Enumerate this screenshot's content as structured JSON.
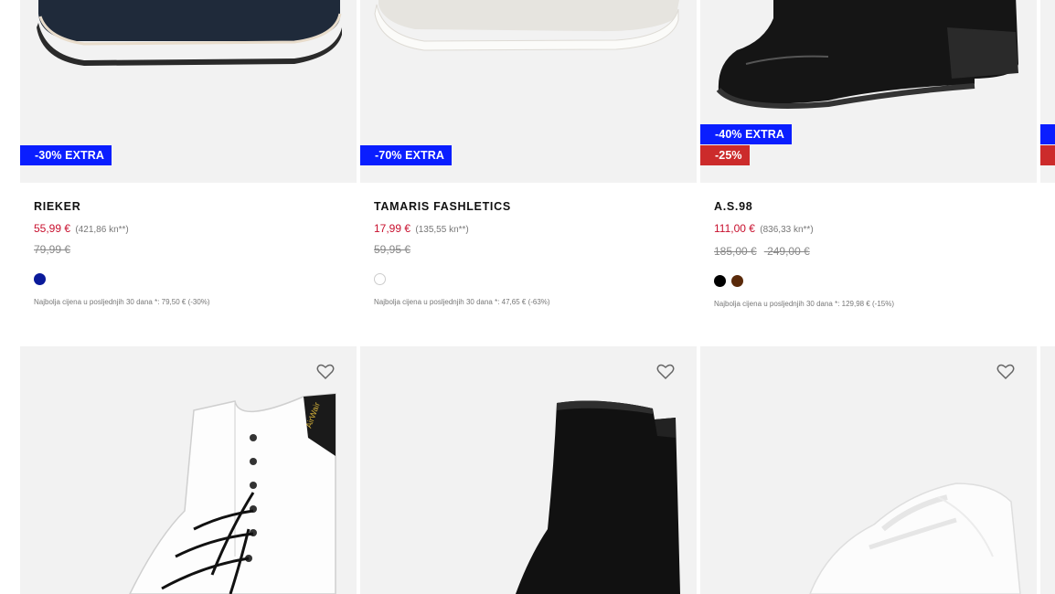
{
  "products_top": [
    {
      "badge_extra": "-30% EXTRA",
      "badge_discount": null,
      "brand": "RIEKER",
      "price": "55,99 €",
      "price_kn": "(421,86 kn**)",
      "old_prices": [
        "79,99 €"
      ],
      "swatches": [
        "#0a1a9a"
      ],
      "lowest_price_note": "Najbolja cijena u posljednjih 30 dana *: 79,50 € (-30%)"
    },
    {
      "badge_extra": "-70% EXTRA",
      "badge_discount": null,
      "brand": "TAMARIS FASHLETICS",
      "price": "17,99 €",
      "price_kn": "(135,55 kn**)",
      "old_prices": [
        "59,95 €"
      ],
      "swatches": [
        "#ffffff"
      ],
      "lowest_price_note": "Najbolja cijena u posljednjih 30 dana *: 47,65 € (-63%)"
    },
    {
      "badge_extra": "-40% EXTRA",
      "badge_discount": "-25%",
      "brand": "A.S.98",
      "price": "111,00 €",
      "price_kn": "(836,33 kn**)",
      "old_prices": [
        "185,00 €",
        "249,00 €"
      ],
      "swatches": [
        "#000000",
        "#5a2a0a"
      ],
      "lowest_price_note": "Najbolja cijena u posljednjih 30 dana *: 129,98 € (-15%)"
    }
  ],
  "products_bottom": [
    {
      "image": "white-lace-up-boot",
      "favorite_icon": "heart-outline-icon"
    },
    {
      "image": "black-sock-ankle-boot",
      "favorite_icon": "heart-outline-icon"
    },
    {
      "image": "white-sneaker",
      "favorite_icon": "heart-outline-icon"
    }
  ],
  "colors": {
    "extra_badge": "#0a1eff",
    "discount_badge": "#cc2b2b",
    "sale_price": "#c8102e",
    "image_bg": "#f2f2f2"
  }
}
